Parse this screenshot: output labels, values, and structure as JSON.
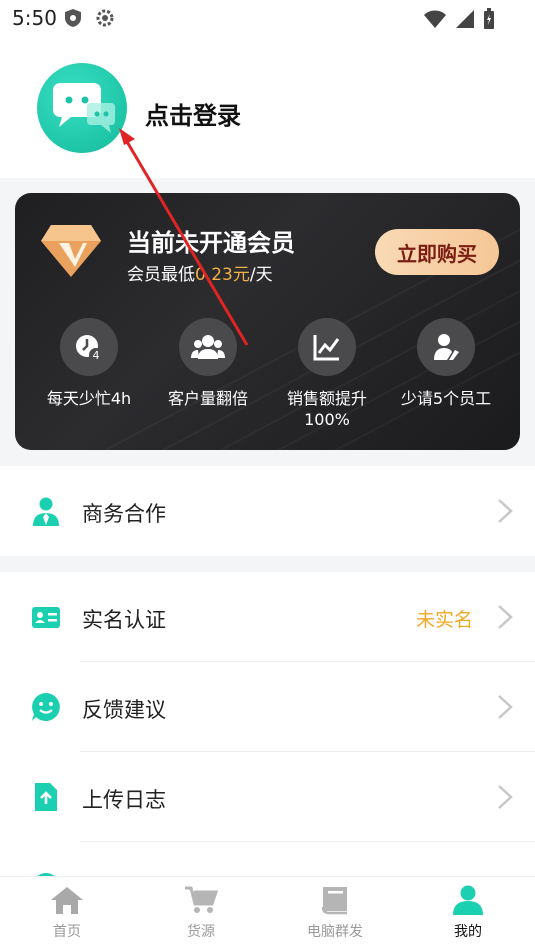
{
  "status": {
    "time": "5:50"
  },
  "profile": {
    "login_label": "点击登录"
  },
  "vip": {
    "title": "当前未开通会员",
    "subtitle_prefix": "会员最低",
    "price": "0.23元",
    "subtitle_suffix": "/天",
    "buy_label": "立即购买",
    "perks": [
      {
        "label": "每天少忙4h",
        "icon": "clock-4-icon"
      },
      {
        "label": "客户量翻倍",
        "icon": "group-icon"
      },
      {
        "label": "销售额提升\n100%",
        "icon": "chart-up-icon"
      },
      {
        "label": "少请5个员工",
        "icon": "worker-icon"
      }
    ]
  },
  "menu": {
    "business": "商务合作",
    "realname": "实名认证",
    "realname_status": "未实名",
    "feedback": "反馈建议",
    "upload_log": "上传日志"
  },
  "tabs": [
    {
      "label": "首页",
      "icon": "home-icon"
    },
    {
      "label": "货源",
      "icon": "cart-icon"
    },
    {
      "label": "电脑群发",
      "icon": "book-icon"
    },
    {
      "label": "我的",
      "icon": "person-icon",
      "active": true
    }
  ],
  "colors": {
    "accent": "#1bd0b0",
    "gold": "#f2b04b",
    "warning": "#f2a825"
  }
}
